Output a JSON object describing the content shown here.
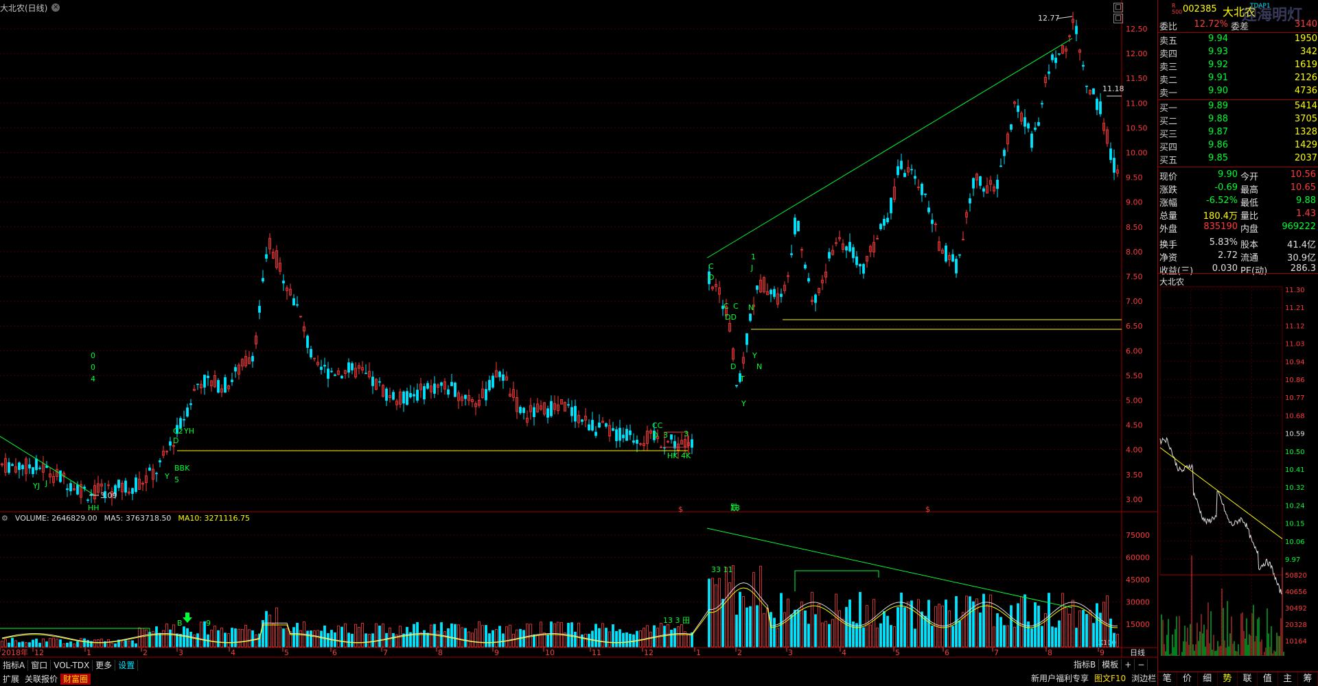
{
  "window": {
    "title": "大北农(日线)"
  },
  "main_chart": {
    "price_ticks": [
      "12.50",
      "12.00",
      "11.50",
      "11.00",
      "10.50",
      "10.00",
      "9.50",
      "9.00",
      "8.50",
      "8.00",
      "7.50",
      "7.00",
      "6.50",
      "6.00",
      "5.50",
      "5.00",
      "4.50",
      "4.00",
      "3.50",
      "3.00"
    ],
    "high_label": "12.77",
    "low_label": "3.09",
    "last_label": "11.18",
    "annotations": [
      "0",
      "0",
      "4",
      "J",
      "YJ",
      "C2",
      "YH",
      "D",
      "Y",
      "5",
      "BBK",
      "CC",
      "D",
      "3",
      "HK",
      "4K",
      "3",
      "C",
      "D",
      "C",
      "C",
      "DD",
      "D",
      "T",
      "Y",
      "1",
      "J",
      "N",
      "Y",
      "N",
      "HH",
      "13",
      "$",
      "跌"
    ],
    "month_labels": [
      "2018年",
      "12",
      "1",
      "2",
      "3",
      "4",
      "5",
      "6",
      "7",
      "8",
      "9",
      "10",
      "11",
      "12",
      "1",
      "2",
      "3",
      "4",
      "5",
      "6",
      "7",
      "8",
      "9"
    ],
    "period_label": "日线"
  },
  "volume": {
    "name": "VOLUME: 2646829.00",
    "ma5": "MA5: 3763718.50",
    "ma10": "MA10: 3271116.75",
    "ticks": [
      "75000",
      "60000",
      "45000",
      "30000",
      "15000"
    ],
    "unit": "X100",
    "annotations": [
      "33 11",
      "13 3 田",
      "B",
      "9"
    ]
  },
  "toolbar_tabs": [
    "指标A",
    "窗口",
    "VOL-TDX",
    "更多",
    "设置"
  ],
  "toolbar_right": [
    "指标B",
    "模板",
    "+",
    "−"
  ],
  "bottom_tabs": [
    "扩展",
    "关联报价",
    "财富圈"
  ],
  "bottom_right": [
    "新用户福利专享",
    "图文F10",
    "浏边栏"
  ],
  "quote": {
    "code": "002385",
    "name": "大北农",
    "tag": "TDAP1",
    "watermark": "迎海明灯",
    "ratio_label": "委比",
    "ratio_value": "12.72%",
    "ratio_diff_label": "委差",
    "ratio_diff": "3140",
    "sells": [
      {
        "label": "卖五",
        "price": "9.94",
        "vol": "1950"
      },
      {
        "label": "卖四",
        "price": "9.93",
        "vol": "342"
      },
      {
        "label": "卖三",
        "price": "9.92",
        "vol": "1619"
      },
      {
        "label": "卖二",
        "price": "9.91",
        "vol": "2126"
      },
      {
        "label": "卖一",
        "price": "9.90",
        "vol": "4736"
      }
    ],
    "buys": [
      {
        "label": "买一",
        "price": "9.89",
        "vol": "5414"
      },
      {
        "label": "买二",
        "price": "9.88",
        "vol": "3705"
      },
      {
        "label": "买三",
        "price": "9.87",
        "vol": "1328"
      },
      {
        "label": "买四",
        "price": "9.86",
        "vol": "1429"
      },
      {
        "label": "买五",
        "price": "9.85",
        "vol": "2037"
      }
    ],
    "stats": [
      {
        "l1": "现价",
        "v1": "9.90",
        "l2": "今开",
        "v2": "10.56"
      },
      {
        "l1": "涨跌",
        "v1": "-0.69",
        "l2": "最高",
        "v2": "10.65"
      },
      {
        "l1": "涨幅",
        "v1": "-6.52%",
        "l2": "最低",
        "v2": "9.88"
      },
      {
        "l1": "总量",
        "v1": "180.4万",
        "l2": "量比",
        "v2": "1.43"
      },
      {
        "l1": "外盘",
        "v1": "835190",
        "l2": "内盘",
        "v2": "969222"
      },
      {
        "l1": "换手",
        "v1": "5.83%",
        "l2": "股本",
        "v2": "41.4亿"
      },
      {
        "l1": "净资",
        "v1": "2.72",
        "l2": "流通",
        "v2": "30.9亿"
      },
      {
        "l1": "收益(三)",
        "v1": "0.030",
        "l2": "PE(动)",
        "v2": "286.3"
      }
    ]
  },
  "mini_chart": {
    "title": "大北农",
    "price_ticks": [
      "11.30",
      "11.21",
      "11.12",
      "11.03",
      "10.94",
      "10.86",
      "10.77",
      "10.68",
      "10.59",
      "10.50",
      "10.41",
      "10.32",
      "10.24",
      "10.15",
      "10.06",
      "9.97"
    ],
    "vol_ticks": [
      "50820",
      "40656",
      "30492",
      "20328",
      "10164"
    ]
  },
  "bottom_quote_tabs": [
    "笔",
    "价",
    "细",
    "势",
    "联",
    "值",
    "主",
    "筹"
  ],
  "colors": {
    "up": "#ff3b3b",
    "down": "#00e5ff",
    "ma": "#ffff00",
    "line": "#00ff33"
  }
}
